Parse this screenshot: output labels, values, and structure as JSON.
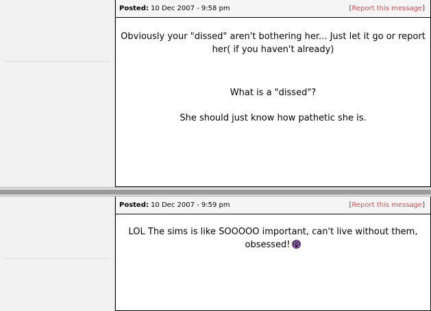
{
  "posts": [
    {
      "posted_label": "Posted:",
      "posted_date": "10 Dec 2007 - 9:58 pm",
      "report_label": "Report this message",
      "paragraphs": [
        "Obviously your \"dissed\" aren't bothering her... Just let it go or report her( if you haven't already)",
        "What is a \"dissed\"?",
        "She should just know how pathetic she is."
      ]
    },
    {
      "posted_label": "Posted:",
      "posted_date": "10 Dec 2007 - 9:59 pm",
      "report_label": "Report this message",
      "paragraphs": [
        "LOL The sims is like SOOOOO important, can't live without them, obsessed!"
      ],
      "emoticon": "shocked-emoticon-icon"
    }
  ]
}
